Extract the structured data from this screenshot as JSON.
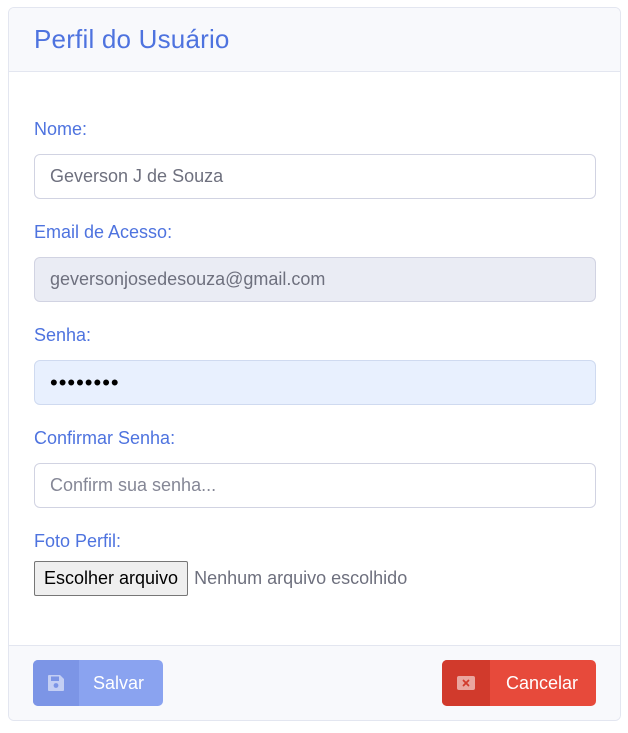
{
  "header": {
    "title": "Perfil do Usuário"
  },
  "form": {
    "nome": {
      "label": "Nome:",
      "value": "Geverson J de Souza"
    },
    "email": {
      "label": "Email de Acesso:",
      "value": "geversonjosedesouza@gmail.com"
    },
    "senha": {
      "label": "Senha:",
      "value": "••••••••"
    },
    "confirmar": {
      "label": "Confirmar Senha:",
      "placeholder": "Confirm sua senha..."
    },
    "foto": {
      "label": "Foto Perfil:",
      "button_label": "Escolher arquivo",
      "status": "Nenhum arquivo escolhido"
    }
  },
  "footer": {
    "save_label": "Salvar",
    "save_icon": "floppy-disk-icon",
    "cancel_label": "Cancelar",
    "cancel_icon": "close-square-icon"
  },
  "colors": {
    "primary": "#4e73df",
    "save": "#8aa3f0",
    "danger": "#e74a3b"
  }
}
